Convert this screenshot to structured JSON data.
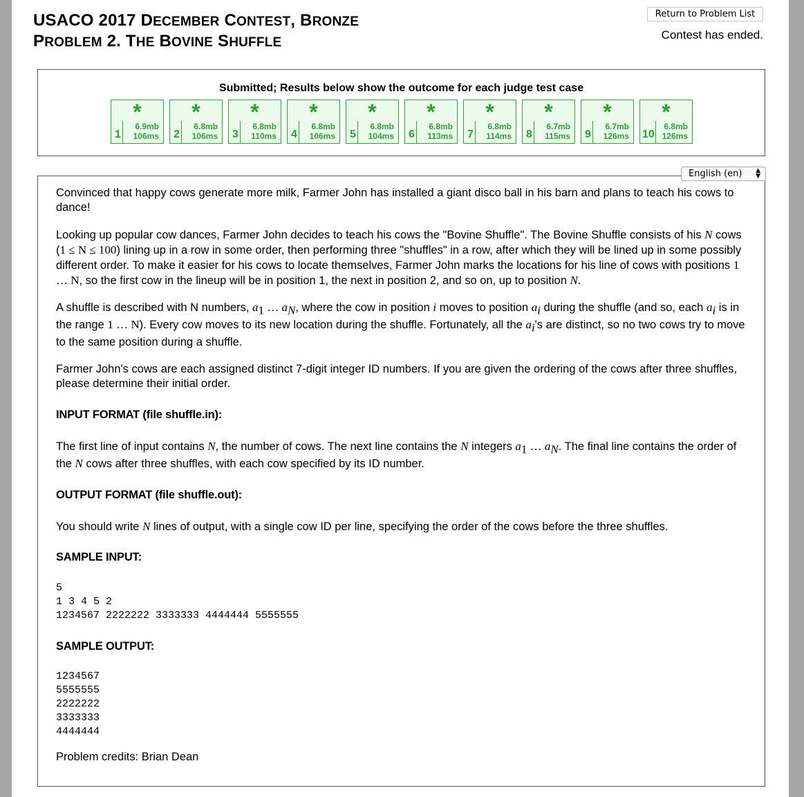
{
  "header": {
    "title_line1_prefix": "USACO 2017 ",
    "title_line1_sc1_big": "D",
    "title_line1_sc1_small": "ECEMBER",
    "title_line1_sc2_big": "C",
    "title_line1_sc2_small": "ONTEST",
    "title_line1_sc3_big": "B",
    "title_line1_sc3_small": "RONZE",
    "title_line2_sc1_big": "P",
    "title_line2_sc1_small": "ROBLEM",
    "title_line2_mid": " 2. ",
    "title_line2_sc2_big": "T",
    "title_line2_sc2_small": "HE",
    "title_line2_sc3_big": "B",
    "title_line2_sc3_small": "OVINE",
    "title_line2_sc4_big": "S",
    "title_line2_sc4_small": "HUFFLE",
    "return_button": "Return to Problem List",
    "status": "Contest has ended."
  },
  "results": {
    "heading": "Submitted; Results below show the outcome for each judge test case",
    "star": "*",
    "cases": [
      {
        "num": "1",
        "mem": "6.9mb",
        "time": "106ms"
      },
      {
        "num": "2",
        "mem": "6.8mb",
        "time": "106ms"
      },
      {
        "num": "3",
        "mem": "6.8mb",
        "time": "110ms"
      },
      {
        "num": "4",
        "mem": "6.8mb",
        "time": "106ms"
      },
      {
        "num": "5",
        "mem": "6.8mb",
        "time": "104ms"
      },
      {
        "num": "6",
        "mem": "6.8mb",
        "time": "113ms"
      },
      {
        "num": "7",
        "mem": "6.8mb",
        "time": "114ms"
      },
      {
        "num": "8",
        "mem": "6.7mb",
        "time": "115ms"
      },
      {
        "num": "9",
        "mem": "6.7mb",
        "time": "126ms"
      },
      {
        "num": "10",
        "mem": "6.8mb",
        "time": "126ms"
      }
    ],
    "success_color": "#2e9e3a"
  },
  "language": {
    "selected": "English (en)"
  },
  "problem": {
    "p1": "Convinced that happy cows generate more milk, Farmer John has installed a giant disco ball in his barn and plans to teach his cows to dance!",
    "p2a": "Looking up popular cow dances, Farmer John decides to teach his cows the \"Bovine Shuffle\". The Bovine Shuffle consists of his ",
    "p2_N1": "N",
    "p2b": " cows (",
    "p2_range": "1 ≤ N ≤ 100",
    "p2c": ") lining up in a row in some order, then performing three \"shuffles\" in a row, after which they will be lined up in some possibly different order. To make it easier for his cows to locate themselves, Farmer John marks the locations for his line of cows with positions ",
    "p2_pos": "1 … N",
    "p2d": ", so the first cow in the lineup will be in position 1, the next in position 2, and so on, up to position ",
    "p2_N2": "N",
    "p2e": ".",
    "p3a": "A shuffle is described with N numbers, ",
    "p3_a1": "a",
    "p3_sub1": "1",
    "p3_dots": " … ",
    "p3_aN": "a",
    "p3_subN": "N",
    "p3b": ", where the cow in position ",
    "p3_i": "i",
    "p3c": " moves to position ",
    "p3_ai": "a",
    "p3_subi": "i",
    "p3d": " during the shuffle (and so, each ",
    "p3_ai2": "a",
    "p3_subi2": "i",
    "p3e": " is in the range ",
    "p3_range": "1 … N",
    "p3f": "). Every cow moves to its new location during the shuffle. Fortunately, all the ",
    "p3_ai3": "a",
    "p3_subi3": "i",
    "p3g": "'s are distinct, so no two cows try to move to the same position during a shuffle.",
    "p4": "Farmer John's cows are each assigned distinct 7-digit integer ID numbers. If you are given the ordering of the cows after three shuffles, please determine their initial order.",
    "input_heading": "INPUT FORMAT (file shuffle.in):",
    "in_a": "The first line of input contains ",
    "in_N1": "N",
    "in_b": ", the number of cows. The next line contains the ",
    "in_N2": "N",
    "in_c": " integers ",
    "in_a1": "a",
    "in_sub1": "1",
    "in_dots": " … ",
    "in_aN": "a",
    "in_subN": "N",
    "in_d": ". The final line contains the order of the ",
    "in_N3": "N",
    "in_e": " cows after three shuffles, with each cow specified by its ID number.",
    "output_heading": "OUTPUT FORMAT (file shuffle.out):",
    "out_a": "You should write ",
    "out_N": "N",
    "out_b": " lines of output, with a single cow ID per line, specifying the order of the cows before the three shuffles.",
    "sample_input_heading": "SAMPLE INPUT:",
    "sample_input": "5\n1 3 4 5 2\n1234567 2222222 3333333 4444444 5555555",
    "sample_output_heading": "SAMPLE OUTPUT:",
    "sample_output": "1234567\n5555555\n2222222\n3333333\n4444444",
    "credits": "Problem credits: Brian Dean"
  }
}
